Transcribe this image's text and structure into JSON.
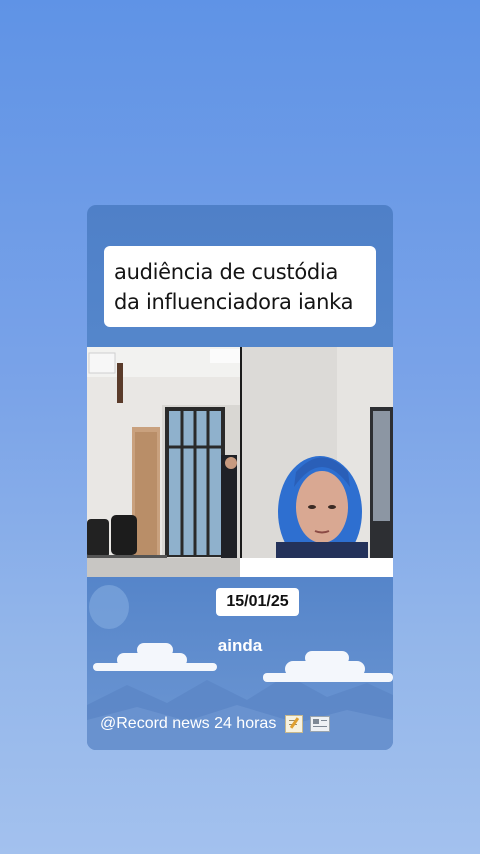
{
  "headline": {
    "line1": "audiência de custódia",
    "line2": "da influenciadora ianka"
  },
  "date": "15/01/25",
  "caption": "ainda",
  "handle": "@Record news 24 horas",
  "handle_emojis": [
    "memo-icon",
    "newspaper-icon"
  ],
  "colors": {
    "background_top": "#5f93e6",
    "background_bottom": "#a3c1ee",
    "card_blue": "#4f80c8",
    "text_dark": "#141414",
    "hair_blue": "#2e6fd0"
  }
}
